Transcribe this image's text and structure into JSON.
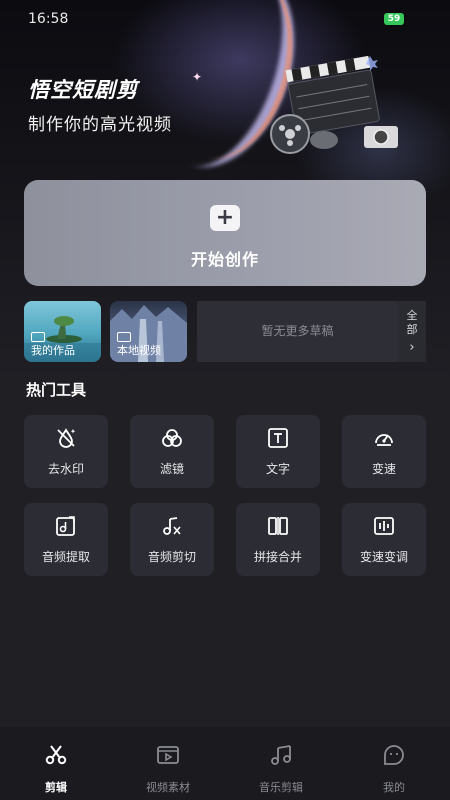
{
  "status_bar": {
    "time": "16:58",
    "battery": "59"
  },
  "header": {
    "app_title": "悟空短剧剪",
    "subtitle": "制作你的高光视频"
  },
  "create": {
    "label": "开始创作",
    "icon": "plus-icon"
  },
  "drafts": {
    "my_works_label": "我的作品",
    "local_video_label": "本地视频",
    "empty_text": "暂无更多草稿",
    "all_label": "全部",
    "all_arrow": "›"
  },
  "tools": {
    "section_title": "热门工具",
    "items": [
      {
        "label": "去水印",
        "icon": "remove-watermark-icon"
      },
      {
        "label": "滤镜",
        "icon": "filter-icon"
      },
      {
        "label": "文字",
        "icon": "text-icon"
      },
      {
        "label": "变速",
        "icon": "speedometer-icon"
      },
      {
        "label": "音频提取",
        "icon": "audio-extract-icon"
      },
      {
        "label": "音频剪切",
        "icon": "audio-cut-icon"
      },
      {
        "label": "拼接合并",
        "icon": "merge-icon"
      },
      {
        "label": "变速变调",
        "icon": "pitch-icon"
      }
    ]
  },
  "bottom_nav": {
    "items": [
      {
        "label": "剪辑",
        "icon": "scissors-icon",
        "active": true
      },
      {
        "label": "视频素材",
        "icon": "video-material-icon",
        "active": false
      },
      {
        "label": "音乐剪辑",
        "icon": "music-note-icon",
        "active": false
      },
      {
        "label": "我的",
        "icon": "profile-icon",
        "active": false
      }
    ]
  },
  "colors": {
    "background": "#1f1f24",
    "card": "#2c2d34",
    "create_card": "#9a9caa",
    "battery": "#35c759"
  }
}
